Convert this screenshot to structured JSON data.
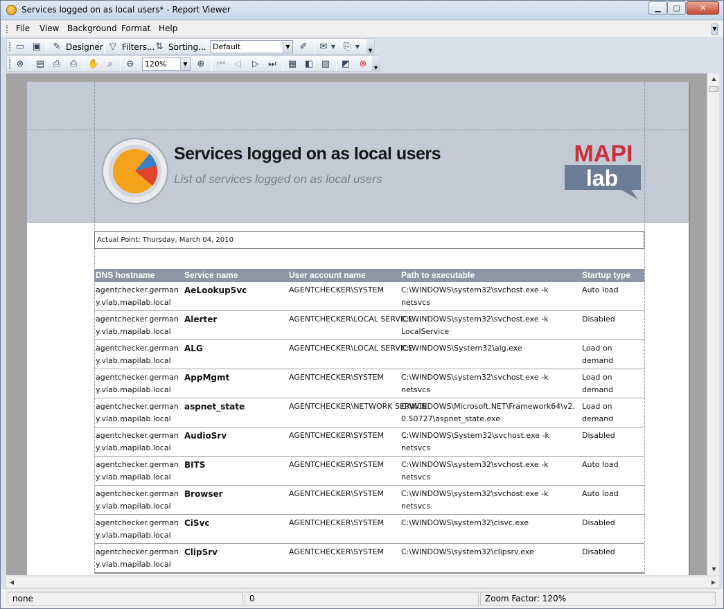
{
  "window": {
    "title": "Services logged on as local users* - Report Viewer"
  },
  "menu": [
    "File",
    "View",
    "Background",
    "Format",
    "Help"
  ],
  "toolbar1": {
    "designer_label": "Designer",
    "filters_label": "Filters...",
    "sorting_label": "Sorting...",
    "style_value": "Default"
  },
  "toolbar2": {
    "zoom_value": "120%"
  },
  "report": {
    "title": "Services logged on as local users",
    "subtitle": "List of services logged on as local users",
    "brand_top": "MAPI",
    "brand_bottom": "lab",
    "actual_point": "Actual Point: Thursday, March 04, 2010",
    "columns": [
      "DNS hostname",
      "Service name",
      "User account name",
      "Path to executable",
      "Startup type"
    ],
    "rows": [
      {
        "dns": "agentchecker.germany.vlab.mapilab.local",
        "service": "AeLookupSvc",
        "user": "AGENTCHECKER\\SYSTEM",
        "path": "C:\\WINDOWS\\system32\\svchost.exe -k netsvcs",
        "startup": "Auto load"
      },
      {
        "dns": "agentchecker.germany.vlab.mapilab.local",
        "service": "Alerter",
        "user": "AGENTCHECKER\\LOCAL SERVICE",
        "path": "C:\\WINDOWS\\system32\\svchost.exe -k LocalService",
        "startup": "Disabled"
      },
      {
        "dns": "agentchecker.germany.vlab.mapilab.local",
        "service": "ALG",
        "user": "AGENTCHECKER\\LOCAL SERVICE",
        "path": "C:\\WINDOWS\\System32\\alg.exe",
        "startup": "Load on demand"
      },
      {
        "dns": "agentchecker.germany.vlab.mapilab.local",
        "service": "AppMgmt",
        "user": "AGENTCHECKER\\SYSTEM",
        "path": "C:\\WINDOWS\\system32\\svchost.exe -k netsvcs",
        "startup": "Load on demand"
      },
      {
        "dns": "agentchecker.germany.vlab.mapilab.local",
        "service": "aspnet_state",
        "user": "AGENTCHECKER\\NETWORK SERVICE",
        "path": "C:\\WINDOWS\\Microsoft.NET\\Framework64\\v2.0.50727\\aspnet_state.exe",
        "startup": "Load on demand"
      },
      {
        "dns": "agentchecker.germany.vlab.mapilab.local",
        "service": "AudioSrv",
        "user": "AGENTCHECKER\\SYSTEM",
        "path": "C:\\WINDOWS\\System32\\svchost.exe -k netsvcs",
        "startup": "Disabled"
      },
      {
        "dns": "agentchecker.germany.vlab.mapilab.local",
        "service": "BITS",
        "user": "AGENTCHECKER\\SYSTEM",
        "path": "C:\\WINDOWS\\system32\\svchost.exe -k netsvcs",
        "startup": "Auto load"
      },
      {
        "dns": "agentchecker.germany.vlab.mapilab.local",
        "service": "Browser",
        "user": "AGENTCHECKER\\SYSTEM",
        "path": "C:\\WINDOWS\\system32\\svchost.exe -k netsvcs",
        "startup": "Auto load"
      },
      {
        "dns": "agentchecker.germany.vlab.mapilab.local",
        "service": "CiSvc",
        "user": "AGENTCHECKER\\SYSTEM",
        "path": "C:\\WINDOWS\\system32\\cisvc.exe",
        "startup": "Disabled"
      },
      {
        "dns": "agentchecker.germany.vlab.mapilab.local",
        "service": "ClipSrv",
        "user": "AGENTCHECKER\\SYSTEM",
        "path": "C:\\WINDOWS\\system32\\clipsrv.exe",
        "startup": "Disabled"
      }
    ]
  },
  "status": {
    "left": "none",
    "middle": "0",
    "zoom": "Zoom Factor: 120%"
  }
}
